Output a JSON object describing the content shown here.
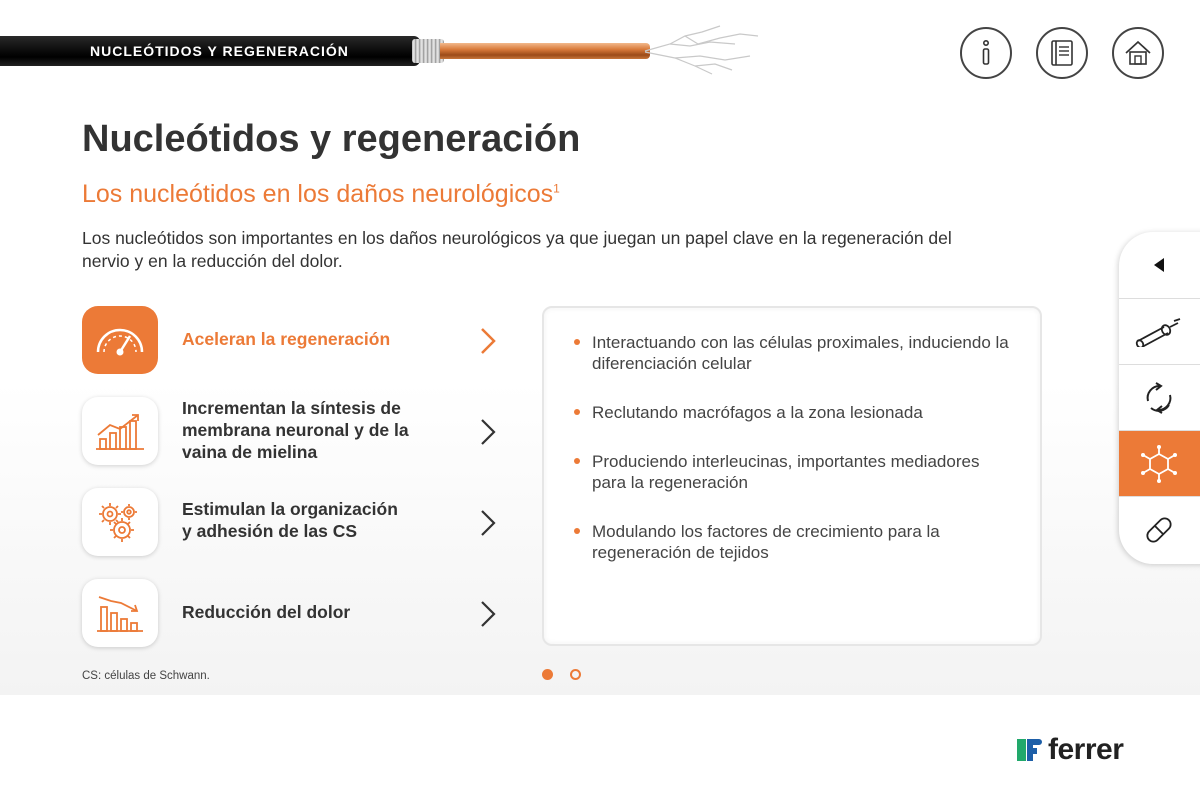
{
  "header": {
    "section_label": "NUCLEÓTIDOS Y REGENERACIÓN",
    "icons": [
      "info-icon",
      "book-icon",
      "home-icon"
    ]
  },
  "main": {
    "title": "Nucleótidos y regeneración",
    "subtitle": "Los nucleótidos en los daños neurológicos",
    "subtitle_ref": "1",
    "intro": "Los nucleótidos son importantes en los daños neurológicos ya que juegan un papel clave en la regeneración del nervio y en la reducción del dolor."
  },
  "features": [
    {
      "label": "Aceleran la regeneración",
      "icon": "speedometer-icon",
      "active": true
    },
    {
      "label": "Incrementan la síntesis de\nmembrana neuronal y de la\nvaina de mielina",
      "icon": "growth-chart-icon",
      "active": false
    },
    {
      "label": "Estimulan la organización\ny adhesión de las CS",
      "icon": "gears-icon",
      "active": false
    },
    {
      "label": "Reducción del dolor",
      "icon": "decline-chart-icon",
      "active": false
    }
  ],
  "panel": {
    "bullets": [
      "Interactuando con las células proximales, induciendo la diferenciación celular",
      "Reclutando macrófagos a la zona lesionada",
      "Produciendo interleucinas, importantes mediadores para la regeneración",
      "Modulando los factores de crecimiento para la regeneración de tejidos"
    ]
  },
  "pagination": {
    "pages": 2,
    "current": 1
  },
  "footnote": "CS: células de Schwann.",
  "sidenav": {
    "items": [
      "back-arrow-icon",
      "cable-icon",
      "cycle-icon",
      "molecule-icon",
      "capsule-icon"
    ],
    "active_index": 3
  },
  "brand": {
    "name": "ferrer",
    "accent": "#ec7a37",
    "logo_green": "#21a96b",
    "logo_blue": "#1d5fa8"
  }
}
